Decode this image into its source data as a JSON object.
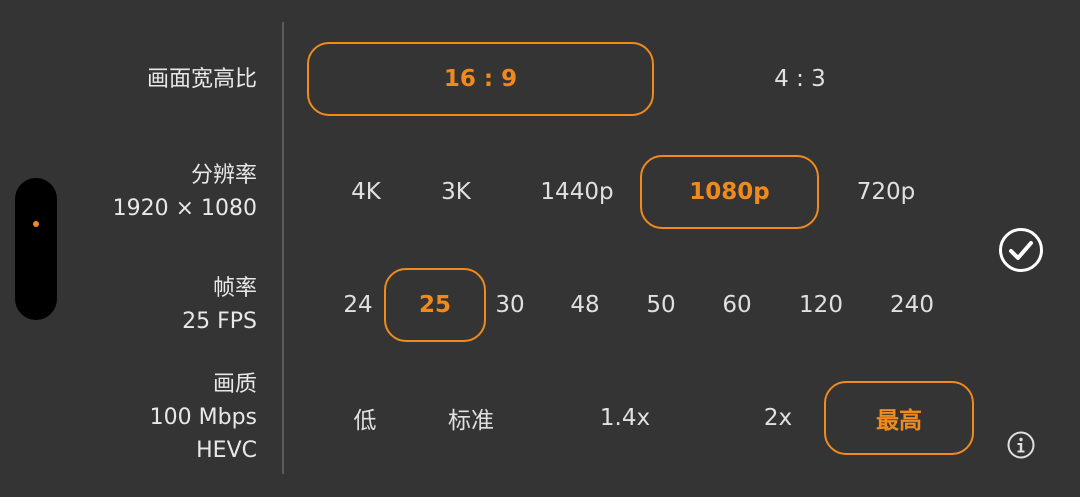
{
  "sidebar": {
    "handle_icon": "drag-handle-icon",
    "accent_color": "#f08a1c"
  },
  "aspect_ratio": {
    "label": "画面宽高比",
    "options": [
      "16 : 9",
      "4 : 3"
    ],
    "selected": "16 : 9"
  },
  "resolution": {
    "label": "分辨率",
    "value": "1920 × 1080",
    "options": [
      "4K",
      "3K",
      "1440p",
      "1080p",
      "720p"
    ],
    "selected": "1080p"
  },
  "frame_rate": {
    "label": "帧率",
    "value": "25 FPS",
    "options": [
      "24",
      "25",
      "30",
      "48",
      "50",
      "60",
      "120",
      "240"
    ],
    "selected": "25"
  },
  "quality": {
    "label": "画质",
    "bitrate": "100 Mbps",
    "codec": "HEVC",
    "options": [
      "低",
      "标准",
      "1.4x",
      "2x",
      "最高"
    ],
    "selected": "最高"
  },
  "actions": {
    "confirm_icon": "checkmark-circle-icon",
    "info_icon": "info-icon"
  }
}
